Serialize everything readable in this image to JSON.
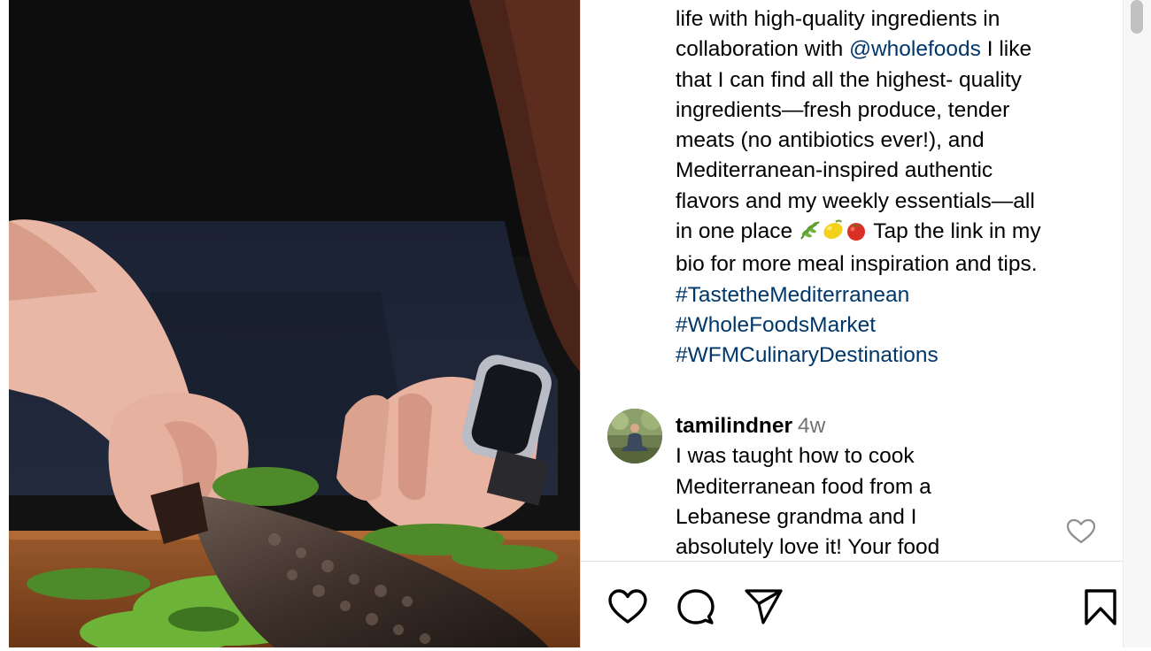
{
  "post": {
    "caption_lines": [
      {
        "text": "life with high-quality ingredients in"
      },
      {
        "before": "collaboration with ",
        "mention": "@wholefoods",
        "after": " I like"
      },
      {
        "text": "that I can find all the highest- quality"
      },
      {
        "text": "ingredients—fresh produce, tender"
      },
      {
        "text": "meats (no antibiotics ever!), and"
      },
      {
        "text": "Mediterranean-inspired authentic"
      },
      {
        "text": "flavors and my weekly essentials—all"
      },
      {
        "before": "in one place ",
        "emojis": [
          "herb-emoji",
          "lemon-emoji",
          "tomato-emoji"
        ],
        "after": " Tap the link in my"
      },
      {
        "text": "bio for more meal inspiration and tips."
      }
    ],
    "hashtags": [
      "#TastetheMediterranean",
      "#WholeFoodsMarket",
      "#WFMCulinaryDestinations"
    ]
  },
  "comment": {
    "username": "tamilindner",
    "age": "4w",
    "text_lines": [
      "I was taught how to cook",
      "Mediterranean food from a",
      "Lebanese grandma and I",
      "absolutely love it! Your food"
    ],
    "like_icon": "heart-outline-icon"
  },
  "actions": {
    "icons": [
      "heart-outline-icon",
      "comment-bubble-icon",
      "share-paper-plane-icon",
      "bookmark-icon"
    ]
  },
  "colors": {
    "link": "#00376b",
    "muted": "#737373",
    "divider": "#dbdbdb"
  }
}
